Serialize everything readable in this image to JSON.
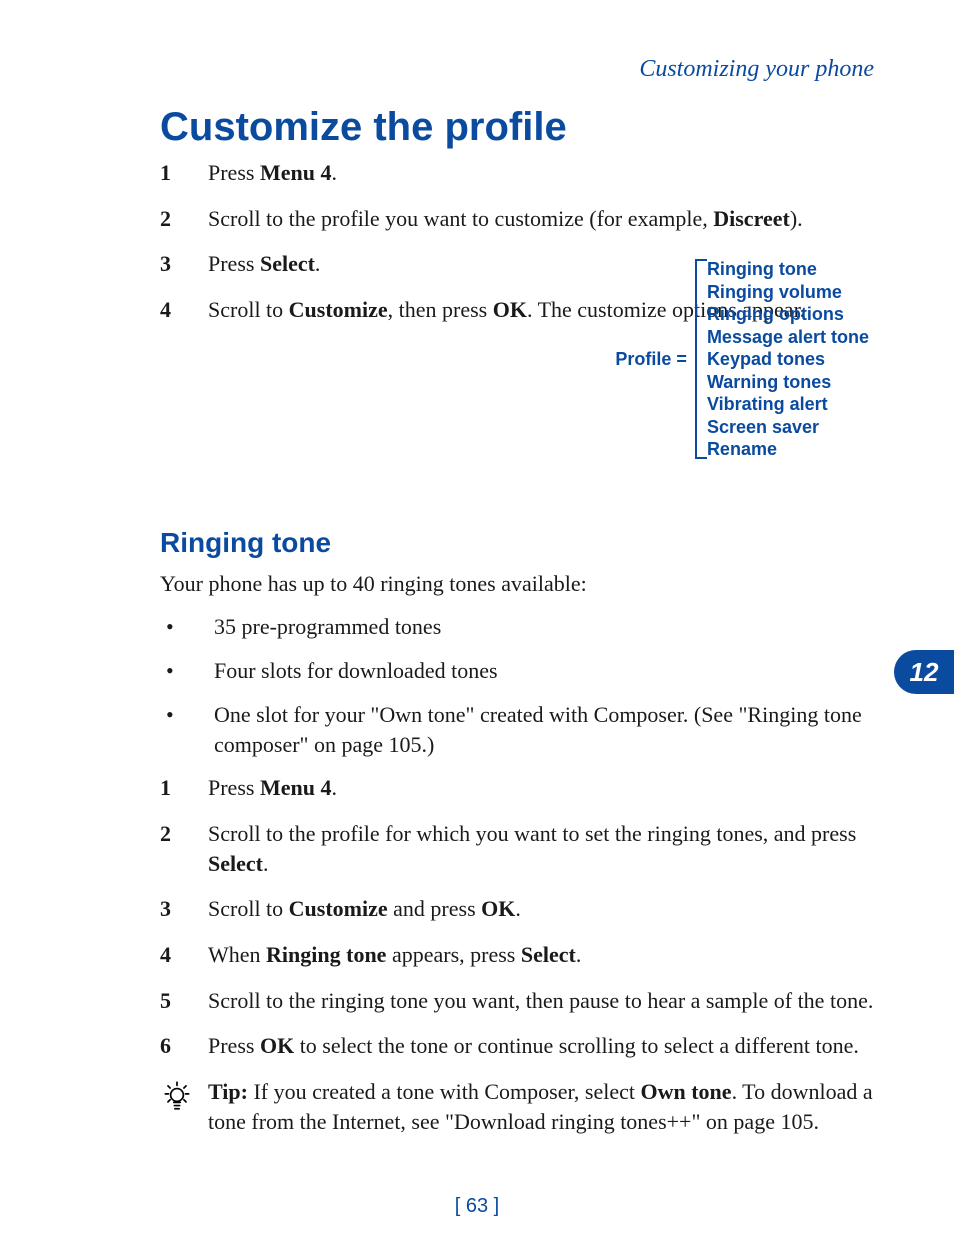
{
  "running_header": "Customizing your phone",
  "section_title": "Customize the profile",
  "steps_a": [
    {
      "num": "1",
      "segments": [
        {
          "t": "Press "
        },
        {
          "t": "Menu 4",
          "b": true
        },
        {
          "t": "."
        }
      ]
    },
    {
      "num": "2",
      "segments": [
        {
          "t": "Scroll to the profile you want to customize (for example, "
        },
        {
          "t": "Discreet",
          "b": true
        },
        {
          "t": ")."
        }
      ]
    },
    {
      "num": "3",
      "segments": [
        {
          "t": "Press "
        },
        {
          "t": "Select",
          "b": true
        },
        {
          "t": "."
        }
      ]
    },
    {
      "num": "4",
      "segments": [
        {
          "t": "Scroll to "
        },
        {
          "t": "Customize",
          "b": true
        },
        {
          "t": ", then press "
        },
        {
          "t": "OK",
          "b": true
        },
        {
          "t": ". The customize options appear."
        }
      ]
    }
  ],
  "profile_label": "Profile =",
  "profile_items": [
    "Ringing tone",
    "Ringing volume",
    "Ringing options",
    "Message alert tone",
    "Keypad tones",
    "Warning tones",
    "Vibrating alert",
    "Screen saver",
    "Rename"
  ],
  "subsection_title": "Ringing tone",
  "intro_text": "Your phone has up to 40 ringing tones available:",
  "bullets": [
    "35 pre-programmed tones",
    "Four slots for downloaded tones",
    "One slot for your \"Own tone\" created with Composer. (See \"Ringing tone composer\" on page 105.)"
  ],
  "steps_b": [
    {
      "num": "1",
      "segments": [
        {
          "t": "Press "
        },
        {
          "t": "Menu 4",
          "b": true
        },
        {
          "t": "."
        }
      ]
    },
    {
      "num": "2",
      "segments": [
        {
          "t": "Scroll to the profile for which you want to set the ringing tones, and press "
        },
        {
          "t": "Select",
          "b": true
        },
        {
          "t": "."
        }
      ]
    },
    {
      "num": "3",
      "segments": [
        {
          "t": "Scroll to "
        },
        {
          "t": "Customize",
          "b": true
        },
        {
          "t": " and press "
        },
        {
          "t": "OK",
          "b": true
        },
        {
          "t": "."
        }
      ]
    },
    {
      "num": "4",
      "segments": [
        {
          "t": "When "
        },
        {
          "t": "Ringing tone",
          "b": true
        },
        {
          "t": " appears, press "
        },
        {
          "t": "Select",
          "b": true
        },
        {
          "t": "."
        }
      ]
    },
    {
      "num": "5",
      "segments": [
        {
          "t": "Scroll to the ringing tone you want, then pause to hear a sample of the tone."
        }
      ]
    },
    {
      "num": "6",
      "segments": [
        {
          "t": "Press "
        },
        {
          "t": "OK",
          "b": true
        },
        {
          "t": " to select the tone or continue scrolling to select a different tone."
        }
      ]
    }
  ],
  "tip_segments": [
    {
      "t": "Tip:",
      "b": true
    },
    {
      "t": " If you created a tone with Composer, select "
    },
    {
      "t": "Own tone",
      "b": true
    },
    {
      "t": ". To download a tone from the Internet, see \"Download ringing tones++\" on page 105."
    }
  ],
  "chapter_number": "12",
  "page_number": "[ 63 ]"
}
